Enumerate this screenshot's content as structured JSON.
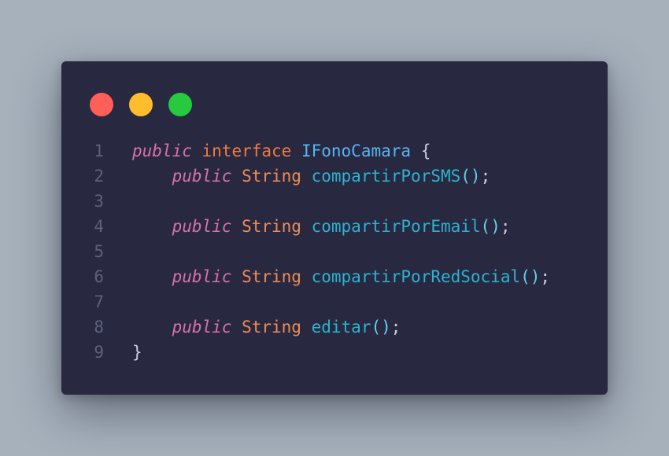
{
  "window": {
    "controls": [
      {
        "name": "close",
        "color": "#ff5f56"
      },
      {
        "name": "minimize",
        "color": "#ffbd2e"
      },
      {
        "name": "maximize",
        "color": "#27c93f"
      }
    ]
  },
  "code": {
    "line_numbers": [
      "1",
      "2",
      "3",
      "4",
      "5",
      "6",
      "7",
      "8",
      "9"
    ],
    "lines": [
      {
        "tokens": [
          {
            "t": "public",
            "k": "kw"
          },
          {
            "t": " ",
            "k": "punct"
          },
          {
            "t": "interface",
            "k": "kw2"
          },
          {
            "t": " ",
            "k": "punct"
          },
          {
            "t": "IFonoCamara",
            "k": "cls"
          },
          {
            "t": " {",
            "k": "punct"
          }
        ]
      },
      {
        "indent": "    ",
        "tokens": [
          {
            "t": "public",
            "k": "kw"
          },
          {
            "t": " ",
            "k": "punct"
          },
          {
            "t": "String",
            "k": "type"
          },
          {
            "t": " ",
            "k": "punct"
          },
          {
            "t": "compartirPorSMS",
            "k": "fn"
          },
          {
            "t": "()",
            "k": "paren"
          },
          {
            "t": ";",
            "k": "punct"
          }
        ]
      },
      {
        "tokens": []
      },
      {
        "indent": "    ",
        "tokens": [
          {
            "t": "public",
            "k": "kw"
          },
          {
            "t": " ",
            "k": "punct"
          },
          {
            "t": "String",
            "k": "type"
          },
          {
            "t": " ",
            "k": "punct"
          },
          {
            "t": "compartirPorEmail",
            "k": "fn"
          },
          {
            "t": "()",
            "k": "paren"
          },
          {
            "t": ";",
            "k": "punct"
          }
        ]
      },
      {
        "tokens": []
      },
      {
        "indent": "    ",
        "tokens": [
          {
            "t": "public",
            "k": "kw"
          },
          {
            "t": " ",
            "k": "punct"
          },
          {
            "t": "String",
            "k": "type"
          },
          {
            "t": " ",
            "k": "punct"
          },
          {
            "t": "compartirPorRedSocial",
            "k": "fn"
          },
          {
            "t": "()",
            "k": "paren"
          },
          {
            "t": ";",
            "k": "punct"
          }
        ]
      },
      {
        "tokens": []
      },
      {
        "indent": "    ",
        "tokens": [
          {
            "t": "public",
            "k": "kw"
          },
          {
            "t": " ",
            "k": "punct"
          },
          {
            "t": "String",
            "k": "type"
          },
          {
            "t": " ",
            "k": "punct"
          },
          {
            "t": "editar",
            "k": "fn"
          },
          {
            "t": "()",
            "k": "paren"
          },
          {
            "t": ";",
            "k": "punct"
          }
        ]
      },
      {
        "tokens": [
          {
            "t": "}",
            "k": "punct"
          }
        ]
      }
    ]
  }
}
